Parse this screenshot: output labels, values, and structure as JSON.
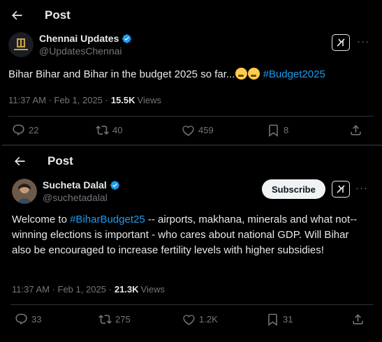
{
  "tweet1": {
    "header_title": "Post",
    "author_name": "Chennai Updates",
    "author_handle": "@UpdatesChennai",
    "text_plain": "Bihar Bihar and Bihar in the budget 2025 so far...",
    "emojis": [
      "sleeping-face",
      "sleeping-face"
    ],
    "hashtag": "#Budget2025",
    "time": "11:37 AM · Feb 1, 2025 · ",
    "views_count": "15.5K",
    "views_label": "Views",
    "replies": "22",
    "reposts": "40",
    "likes": "459",
    "bookmarks": "8"
  },
  "tweet2": {
    "header_title": "Post",
    "author_name": "Sucheta Dalal",
    "author_handle": "@suchetadalal",
    "subscribe_label": "Subscribe",
    "text_before": "Welcome to ",
    "hashtag": "#BiharBudget25",
    "text_after": " -- airports, makhana, minerals and what not-- winning elections is important - who cares about national GDP. Will Bihar also be encouraged to increase fertility levels with higher subsidies!",
    "time": "11:37 AM · Feb 1, 2025 · ",
    "views_count": "21.3K",
    "views_label": "Views",
    "replies": "33",
    "reposts": "275",
    "likes": "1.2K",
    "bookmarks": "31"
  },
  "colors": {
    "background": "#000000",
    "text": "#e7e9ea",
    "muted": "#71767b",
    "link": "#1d9bf0",
    "verified": "#1d9bf0",
    "divider": "#2f3336"
  }
}
